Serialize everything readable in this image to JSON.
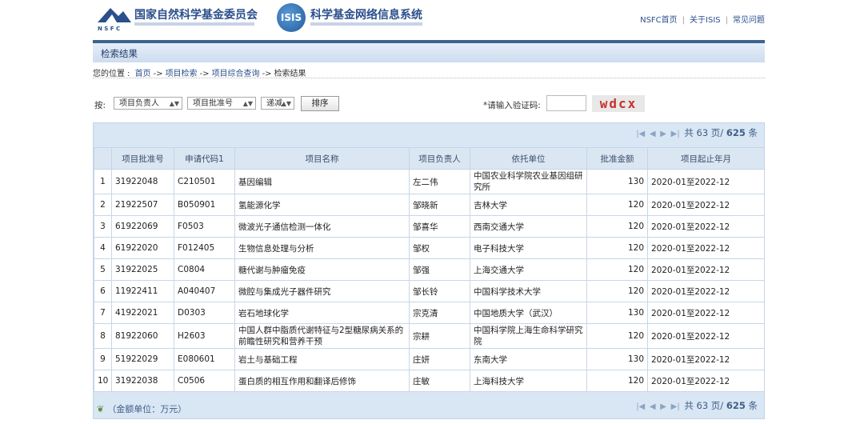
{
  "header": {
    "nsfc_name": "国家自然科学基金委员会",
    "nsfc_logo_text": "N S F C",
    "isis_logo_text": "ISIS",
    "isis_name": "科学基金网络信息系统",
    "links": [
      "NSFC首页",
      "关于ISIS",
      "常见问题"
    ]
  },
  "section_title": "检索结果",
  "breadcrumb": {
    "prefix": "您的位置",
    "items": [
      "首页",
      "项目检索",
      "项目综合查询",
      "检索结果"
    ]
  },
  "controls": {
    "sort_label": "按:",
    "sort_field_1": "项目负责人",
    "sort_field_2": "项目批准号",
    "order": "递减",
    "sort_button": "排序",
    "captcha_label": "*请输入验证码:",
    "captcha_text": "wdcx"
  },
  "pager": {
    "total_prefix": "共",
    "pages": "63",
    "pages_unit": "页/",
    "count": "625",
    "count_unit": "条"
  },
  "table": {
    "columns": [
      "",
      "项目批准号",
      "申请代码1",
      "项目名称",
      "项目负责人",
      "依托单位",
      "批准金额",
      "项目起止年月"
    ],
    "rows": [
      [
        "1",
        "31922048",
        "C210501",
        "基因编辑",
        "左二伟",
        "中国农业科学院农业基因组研究所",
        "130",
        "2020-01至2022-12"
      ],
      [
        "2",
        "21922507",
        "B050901",
        "氢能源化学",
        "邹晓新",
        "吉林大学",
        "120",
        "2020-01至2022-12"
      ],
      [
        "3",
        "61922069",
        "F0503",
        "微波光子通信检测一体化",
        "邹喜华",
        "西南交通大学",
        "120",
        "2020-01至2022-12"
      ],
      [
        "4",
        "61922020",
        "F012405",
        "生物信息处理与分析",
        "邹权",
        "电子科技大学",
        "120",
        "2020-01至2022-12"
      ],
      [
        "5",
        "31922025",
        "C0804",
        "糖代谢与肿瘤免疫",
        "邹强",
        "上海交通大学",
        "120",
        "2020-01至2022-12"
      ],
      [
        "6",
        "11922411",
        "A040407",
        "微腔与集成光子器件研究",
        "邹长铃",
        "中国科学技术大学",
        "120",
        "2020-01至2022-12"
      ],
      [
        "7",
        "41922021",
        "D0303",
        "岩石地球化学",
        "宗克清",
        "中国地质大学（武汉）",
        "130",
        "2020-01至2022-12"
      ],
      [
        "8",
        "81922060",
        "H2603",
        "中国人群中脂质代谢特征与2型糖尿病关系的前瞻性研究和营养干预",
        "宗耕",
        "中国科学院上海生命科学研究院",
        "120",
        "2020-01至2022-12"
      ],
      [
        "9",
        "51922029",
        "E080601",
        "岩土与基础工程",
        "庄妍",
        "东南大学",
        "130",
        "2020-01至2022-12"
      ],
      [
        "10",
        "31922038",
        "C0506",
        "蛋白质的相互作用和翻译后修饰",
        "庄敏",
        "上海科技大学",
        "120",
        "2020-01至2022-12"
      ]
    ]
  },
  "footer_note": "（金额单位：万元）"
}
